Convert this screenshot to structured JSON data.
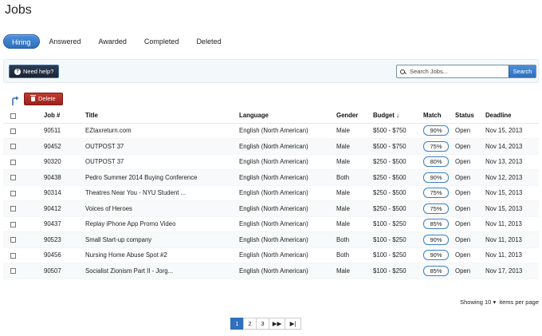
{
  "page": {
    "title": "Jobs"
  },
  "tabs": [
    {
      "label": "Hiring",
      "active": true
    },
    {
      "label": "Answered",
      "active": false
    },
    {
      "label": "Awarded",
      "active": false
    },
    {
      "label": "Completed",
      "active": false
    },
    {
      "label": "Deleted",
      "active": false
    }
  ],
  "toolbar": {
    "help_label": "Need help?",
    "search_placeholder": "Search Jobs...",
    "search_button": "Search",
    "delete_label": "Delete"
  },
  "table": {
    "headers": {
      "job": "Job #",
      "title": "Title",
      "language": "Language",
      "gender": "Gender",
      "budget": "Budget",
      "match": "Match",
      "status": "Status",
      "deadline": "Deadline"
    },
    "rows": [
      {
        "job": "90511",
        "title": "EZtaxreturn.com",
        "language": "English (North American)",
        "gender": "Male",
        "budget": "$500 - $750",
        "match": "90%",
        "status": "Open",
        "deadline": "Nov 15, 2013"
      },
      {
        "job": "90452",
        "title": "OUTPOST 37",
        "language": "English (North American)",
        "gender": "Male",
        "budget": "$500 - $750",
        "match": "75%",
        "status": "Open",
        "deadline": "Nov 14, 2013"
      },
      {
        "job": "90320",
        "title": "OUTPOST 37",
        "language": "English (North American)",
        "gender": "Male",
        "budget": "$250 - $500",
        "match": "80%",
        "status": "Open",
        "deadline": "Nov 13, 2013"
      },
      {
        "job": "90438",
        "title": "Pedro Summer 2014 Buying Conference",
        "language": "English (North American)",
        "gender": "Both",
        "budget": "$250 - $500",
        "match": "90%",
        "status": "Open",
        "deadline": "Nov 12, 2013"
      },
      {
        "job": "90314",
        "title": "Theatres Near You - NYU Student ...",
        "language": "English (North American)",
        "gender": "Male",
        "budget": "$250 - $500",
        "match": "75%",
        "status": "Open",
        "deadline": "Nov 15, 2013"
      },
      {
        "job": "90412",
        "title": "Voices of Heroes",
        "language": "English (North American)",
        "gender": "Male",
        "budget": "$250 - $500",
        "match": "75%",
        "status": "Open",
        "deadline": "Nov 15, 2013"
      },
      {
        "job": "90437",
        "title": "Replay iPhone App Promo Video",
        "language": "English (North American)",
        "gender": "Male",
        "budget": "$100 - $250",
        "match": "85%",
        "status": "Open",
        "deadline": "Nov 11, 2013"
      },
      {
        "job": "90523",
        "title": "Small Start-up company",
        "language": "English (North American)",
        "gender": "Both",
        "budget": "$100 - $250",
        "match": "90%",
        "status": "Open",
        "deadline": "Nov 11, 2013"
      },
      {
        "job": "90456",
        "title": "Nursing Home Abuse Spot #2",
        "language": "English (North American)",
        "gender": "Both",
        "budget": "$100 - $250",
        "match": "90%",
        "status": "Open",
        "deadline": "Nov 11, 2013"
      },
      {
        "job": "90507",
        "title": "Socialist Zionism Part II - Jorg...",
        "language": "English (North American)",
        "gender": "Male",
        "budget": "$100 - $250",
        "match": "85%",
        "status": "Open",
        "deadline": "Nov 17, 2013"
      }
    ]
  },
  "footer": {
    "showing_prefix": "Showing",
    "per_page_value": "10",
    "per_page_suffix": "items per page"
  },
  "pagination": {
    "pages": [
      "1",
      "2",
      "3"
    ],
    "current": "1",
    "next_icon": "fast-forward-icon",
    "last_icon": "skip-to-end-icon"
  },
  "colors": {
    "accent": "#2f6fbd",
    "danger": "#9d221c",
    "open_status": "#2aa55a"
  }
}
